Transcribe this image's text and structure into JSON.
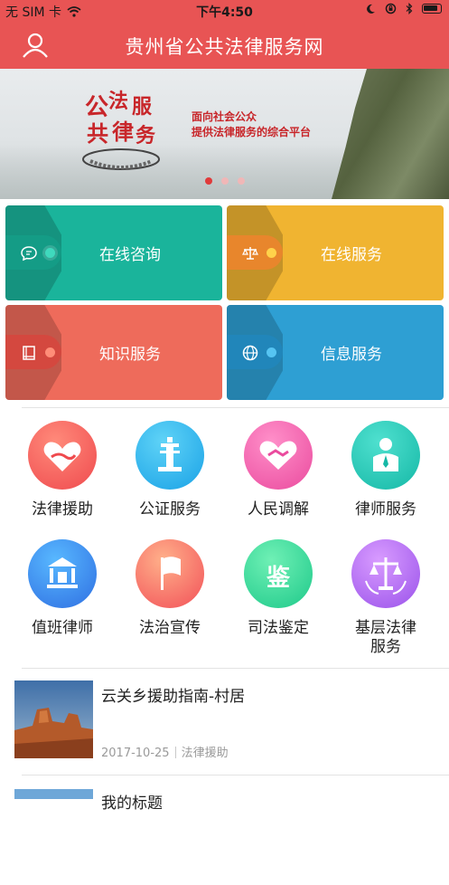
{
  "status_bar": {
    "carrier": "无 SIM 卡",
    "time": "下午4:50"
  },
  "header": {
    "title": "贵州省公共法律服务网"
  },
  "banner": {
    "logo_chars": [
      "公",
      "法",
      "服",
      "共",
      "律",
      "务"
    ],
    "slogan_line1": "面向社会公众",
    "slogan_line2": "提供法律服务的综合平台",
    "active_slide": 1,
    "slide_count": 3
  },
  "tiles": [
    {
      "label": "在线咨询",
      "icon": "chat-bubble-icon",
      "color": "#1ab49b"
    },
    {
      "label": "在线服务",
      "icon": "scales-icon",
      "color": "#f0b431"
    },
    {
      "label": "知识服务",
      "icon": "book-icon",
      "color": "#ee6b5b"
    },
    {
      "label": "信息服务",
      "icon": "globe-icon",
      "color": "#2e9fd3"
    }
  ],
  "services": [
    {
      "label": "法律援助",
      "icon": "heart-hands-icon"
    },
    {
      "label": "公证服务",
      "icon": "notary-pillar-icon"
    },
    {
      "label": "人民调解",
      "icon": "handshake-icon"
    },
    {
      "label": "律师服务",
      "icon": "lawyer-icon"
    },
    {
      "label": "值班律师",
      "icon": "courthouse-icon"
    },
    {
      "label": "法治宣传",
      "icon": "flag-icon"
    },
    {
      "label": "司法鉴定",
      "icon": "appraisal-icon",
      "glyph": "鉴"
    },
    {
      "label": "基层法律服务",
      "label_line1": "基层法律",
      "label_line2": "服务",
      "icon": "scales-badge-icon"
    }
  ],
  "news": [
    {
      "title": "云关乡援助指南-村居",
      "date": "2017-10-25",
      "category": "法律援助"
    },
    {
      "title": "我的标题"
    }
  ]
}
